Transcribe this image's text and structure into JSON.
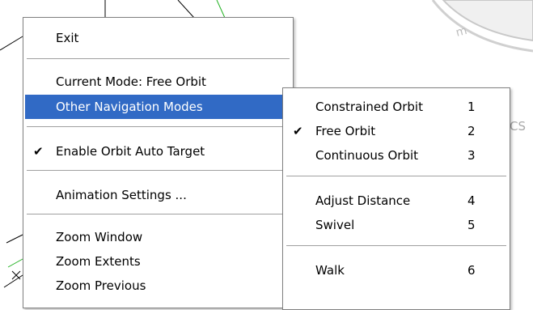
{
  "background": {
    "viewcube_label": "CS"
  },
  "main_menu": {
    "exit": "Exit",
    "current_mode": "Current Mode: Free Orbit",
    "other_navigation_modes": "Other Navigation Modes",
    "enable_orbit_auto_target": "Enable Orbit Auto Target",
    "animation_settings": "Animation Settings ...",
    "zoom_window": "Zoom Window",
    "zoom_extents": "Zoom Extents",
    "zoom_previous": "Zoom Previous"
  },
  "sub_menu": {
    "items": [
      {
        "label": "Constrained Orbit",
        "shortcut": "1",
        "checked": false
      },
      {
        "label": "Free Orbit",
        "shortcut": "2",
        "checked": true
      },
      {
        "label": "Continuous Orbit",
        "shortcut": "3",
        "checked": false
      },
      {
        "label": "Adjust Distance",
        "shortcut": "4",
        "checked": false
      },
      {
        "label": "Swivel",
        "shortcut": "5",
        "checked": false
      },
      {
        "label": "Walk",
        "shortcut": "6",
        "checked": false
      }
    ]
  },
  "colors": {
    "highlight": "#316ac5",
    "menu_border": "#7f7f7f"
  }
}
